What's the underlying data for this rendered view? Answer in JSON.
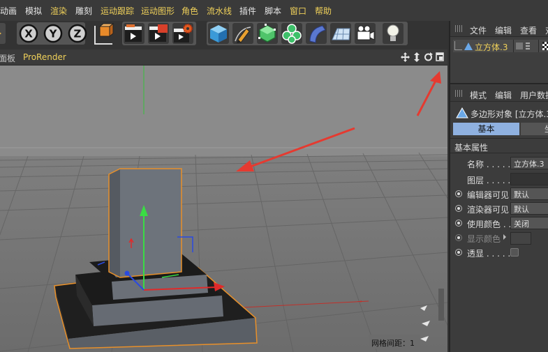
{
  "menu": {
    "items": [
      {
        "label": "动画",
        "highlight": false
      },
      {
        "label": "模拟",
        "highlight": false
      },
      {
        "label": "渲染",
        "highlight": true
      },
      {
        "label": "雕刻",
        "highlight": false
      },
      {
        "label": "运动跟踪",
        "highlight": true
      },
      {
        "label": "运动图形",
        "highlight": true
      },
      {
        "label": "角色",
        "highlight": true
      },
      {
        "label": "流水线",
        "highlight": true
      },
      {
        "label": "插件",
        "highlight": false
      },
      {
        "label": "脚本",
        "highlight": false
      },
      {
        "label": "窗口",
        "highlight": true
      },
      {
        "label": "帮助",
        "highlight": true
      }
    ]
  },
  "toolbar": {
    "x_label": "X",
    "y_label": "Y",
    "z_label": "Z"
  },
  "viewport": {
    "left_label": "面板",
    "prorender_label": "ProRender",
    "grid_spacing_label": "网格间距：1"
  },
  "object_manager": {
    "menu": [
      "文件",
      "编辑",
      "查看",
      "对"
    ],
    "object_name": "立方体.3"
  },
  "attributes": {
    "menu": [
      "模式",
      "编辑",
      "用户数据"
    ],
    "object_title": "多边形对象 [立方体.3]",
    "tab_basic": "基本",
    "tab_coord": "坐",
    "section": "基本属性",
    "rows": [
      {
        "label": "名称 . . . . .",
        "value": "立方体.3",
        "radio": false,
        "disabled": false
      },
      {
        "label": "图层 . . . . .",
        "value": "",
        "radio": false,
        "disabled": false
      },
      {
        "label": "编辑器可见",
        "value": "默认",
        "radio": true,
        "disabled": false
      },
      {
        "label": "渲染器可见",
        "value": "默认",
        "radio": true,
        "disabled": false
      },
      {
        "label": "使用颜色 . .",
        "value": "关闭",
        "radio": true,
        "disabled": false
      },
      {
        "label": "显示颜色",
        "value": "",
        "radio": true,
        "disabled": true
      },
      {
        "label": "透显 . . . . .",
        "value": "",
        "radio": true,
        "disabled": false
      }
    ]
  },
  "colors": {
    "accent": "#f0d15a",
    "selection_orange": "#e8902a",
    "arrow_red": "#e53a30",
    "tab_active": "#8fb1e0"
  }
}
